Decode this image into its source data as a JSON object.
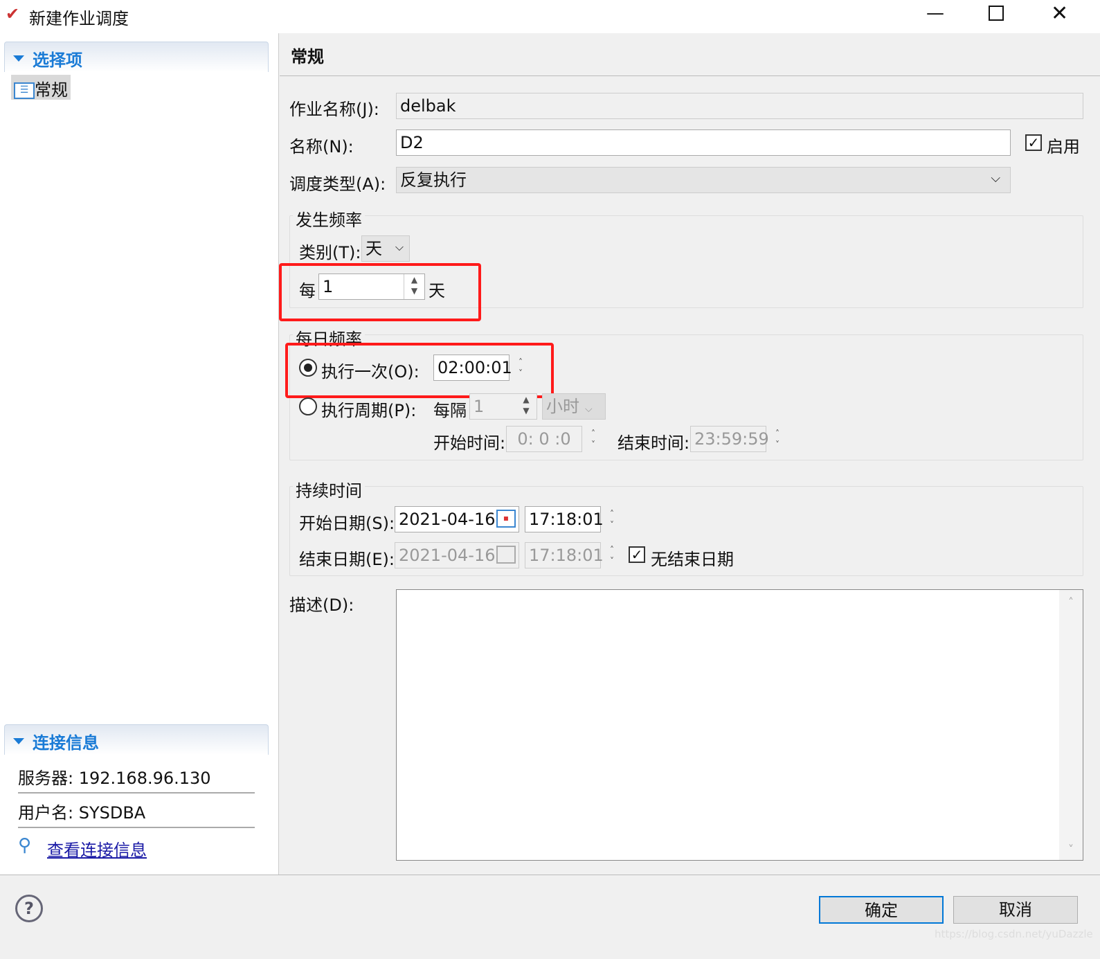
{
  "window": {
    "title": "新建作业调度",
    "icon": "job-schedule-icon"
  },
  "sidebar": {
    "section1": "选择项",
    "items": [
      {
        "label": "常规",
        "icon": "list-icon"
      }
    ],
    "section2": "连接信息",
    "server": "服务器: 192.168.96.130",
    "user": "用户名: SYSDBA",
    "view_link": "查看连接信息"
  },
  "main": {
    "title": "常规",
    "job_name_label": "作业名称(J):",
    "job_name": "delbak",
    "name_label": "名称(N):",
    "name": "D2",
    "enable_label": "启用",
    "enabled": true,
    "type_label": "调度类型(A):",
    "type": "反复执行",
    "freq": {
      "title": "发生频率",
      "category_label": "类别(T):",
      "category": "天",
      "every_label": "每",
      "every_value": "1",
      "unit": "天"
    },
    "daily": {
      "title": "每日频率",
      "once_label": "执行一次(O):",
      "once_time": "02:00:01",
      "once_selected": true,
      "period_label": "执行周期(P):",
      "interval_label": "每隔",
      "interval": "1",
      "interval_unit": "小时",
      "start_label": "开始时间:",
      "start": "0: 0 :0",
      "end_label": "结束时间:",
      "end": "23:59:59"
    },
    "duration": {
      "title": "持续时间",
      "start_date_label": "开始日期(S):",
      "start_date": "2021-04-16",
      "start_time": "17:18:01",
      "end_date_label": "结束日期(E):",
      "end_date": "2021-04-16",
      "end_time": "17:18:01",
      "no_end_label": "无结束日期",
      "no_end": true
    },
    "desc_label": "描述(D):",
    "desc": ""
  },
  "footer": {
    "ok": "确定",
    "cancel": "取消"
  },
  "watermark": "https://blog.csdn.net/yuDazzle",
  "colors": {
    "accent": "#1a7bd6",
    "highlight": "#ff1a1a"
  }
}
